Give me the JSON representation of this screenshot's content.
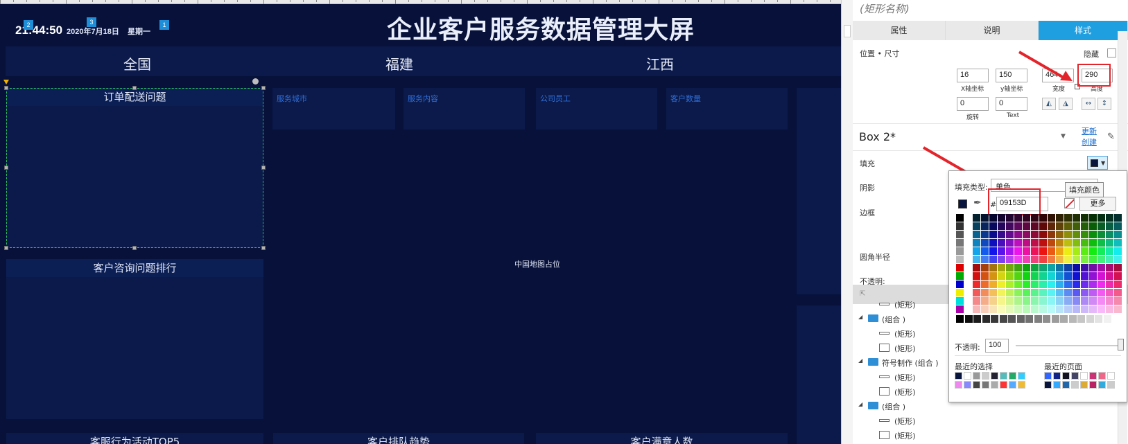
{
  "canvas": {
    "title": "企业客户服务数据管理大屏",
    "clock": "21:44:50",
    "date": "2020年7月18日",
    "weekday": "星期一",
    "badges": [
      "2",
      "3",
      "1"
    ],
    "regions": [
      "全国",
      "福建",
      "江西"
    ],
    "panels": {
      "order_delivery": "订单配送问题",
      "consult_rank": "客户咨询问题排行",
      "service_top5": "客服行为活动TOP5",
      "queue_trend": "客户排队趋势",
      "satisfaction": "客户满意人数"
    },
    "cards": [
      "服务城市",
      "服务内容",
      "公司员工",
      "客户数量"
    ],
    "map_placeholder": "中国地图占位",
    "bg_color": "#07113a"
  },
  "inspector": {
    "shape_name": "(矩形名称)",
    "tabs": [
      "属性",
      "说明",
      "样式"
    ],
    "active_tab": "样式",
    "section_position": "位置 • 尺寸",
    "hide_label": "隐藏",
    "x": "16",
    "x_label": "X轴坐标",
    "y": "150",
    "y_label": "y轴坐标",
    "width": "464",
    "width_label": "宽度",
    "height": "290",
    "height_label": "高度",
    "rotate": "0",
    "rotate_label": "旋转",
    "text_rotate": "0",
    "text_rotate_label": "Text",
    "style_name": "Box 2*",
    "update_link": "更新",
    "create_link": "创建",
    "fill_label": "填充",
    "shadow_label": "阴影",
    "border_label": "边框",
    "radius_label": "圆角半径",
    "opacity_label": "不透明:"
  },
  "fill_popup": {
    "type_label": "填充类型:",
    "type_value": "单色",
    "tooltip": "填充颜色",
    "hex_prefix": "#",
    "hex_value": "09153D",
    "more_button": "更多",
    "opacity_label": "不透明:",
    "opacity_value": "100",
    "recent_label": "最近的选择",
    "recent_page_label": "最近的页面",
    "current_color": "#09153D"
  },
  "layers": [
    {
      "label": "(矩形)",
      "type": "line"
    },
    {
      "label": "(组合 )",
      "type": "group"
    },
    {
      "label": "(矩形)",
      "type": "line"
    },
    {
      "label": "(矩形)",
      "type": "rect"
    },
    {
      "label": "符号制作 (组合 )",
      "type": "group"
    },
    {
      "label": "(矩形)",
      "type": "line"
    },
    {
      "label": "(矩形)",
      "type": "rect"
    },
    {
      "label": "(组合 )",
      "type": "group"
    },
    {
      "label": "(矩形)",
      "type": "line"
    },
    {
      "label": "(矩形)",
      "type": "rect"
    }
  ]
}
